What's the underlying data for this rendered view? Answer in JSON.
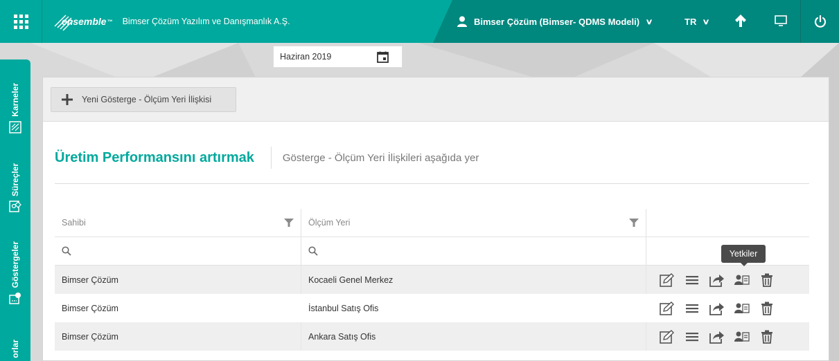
{
  "topbar": {
    "logo_text": "ensemble",
    "logo_tm": "™",
    "company": "Bimser Çözüm Yazılım ve Danışmanlık A.Ş.",
    "user": "Bimser Çözüm (Bimser- QDMS Modeli)",
    "language": "TR",
    "accent": "#00a99d",
    "accent_dark": "#00877e"
  },
  "sidebar": {
    "tabs": [
      {
        "label": "Karneler",
        "icon": "scorecard-icon"
      },
      {
        "label": "Süreçler",
        "icon": "process-icon"
      },
      {
        "label": "Göstergeler",
        "icon": "indicator-icon"
      },
      {
        "label": "orlar",
        "icon": "report-icon"
      }
    ]
  },
  "date": {
    "value": "Haziran 2019"
  },
  "panel": {
    "new_button": "Yeni Gösterge - Ölçüm Yeri İlişkisi",
    "title": "Üretim Performansını artırmak",
    "subtitle": "Gösterge - Ölçüm Yeri İlişkileri aşağıda yer"
  },
  "table": {
    "headers": [
      "Sahibi",
      "Ölçüm Yeri",
      ""
    ],
    "rows": [
      {
        "owner": "Bimser Çözüm",
        "location": "Kocaeli Genel Merkez"
      },
      {
        "owner": "Bimser Çözüm",
        "location": "İstanbul Satış Ofis"
      },
      {
        "owner": "Bimser Çözüm",
        "location": "Ankara Satış Ofis"
      }
    ],
    "actions": [
      "edit-icon",
      "list-icon",
      "share-icon",
      "permissions-icon",
      "delete-icon"
    ]
  },
  "tooltip": {
    "text": "Yetkiler"
  }
}
